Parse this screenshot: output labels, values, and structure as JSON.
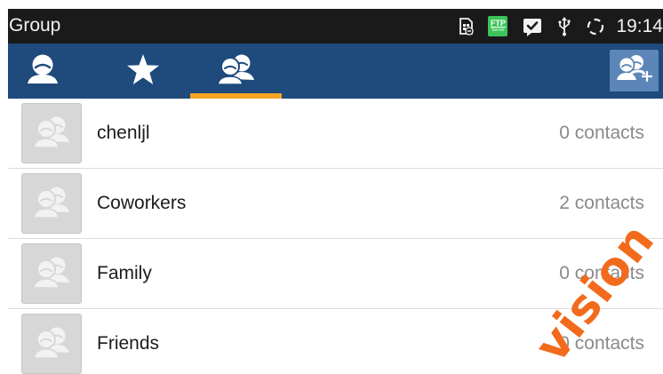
{
  "status_bar": {
    "title": "Group",
    "ftp_badge_line1": "FTP",
    "ftp_badge_line2": "Server",
    "time": "19:14",
    "icons": [
      "sim-card-icon",
      "ftp-server-icon",
      "message-check-icon",
      "usb-icon",
      "sync-icon"
    ]
  },
  "tabs": [
    {
      "name": "contacts",
      "icon": "person-icon",
      "active": false
    },
    {
      "name": "favorites",
      "icon": "star-icon",
      "active": false
    },
    {
      "name": "groups",
      "icon": "group-icon",
      "active": true
    }
  ],
  "toolbar": {
    "add_group_icon": "add-group-icon"
  },
  "groups": [
    {
      "name": "chenljl",
      "count": "0 contacts"
    },
    {
      "name": "Coworkers",
      "count": "2 contacts"
    },
    {
      "name": "Family",
      "count": "0 contacts"
    },
    {
      "name": "Friends",
      "count": "0 contacts"
    }
  ],
  "watermark": "vision",
  "colors": {
    "status_bar_bg": "#1a1a1a",
    "tab_bar_bg": "#1e4a7c",
    "tab_indicator": "#f3a521",
    "add_button_bg": "#5b86b7",
    "ftp_green": "#3cc45a",
    "watermark": "#f26a1b"
  }
}
